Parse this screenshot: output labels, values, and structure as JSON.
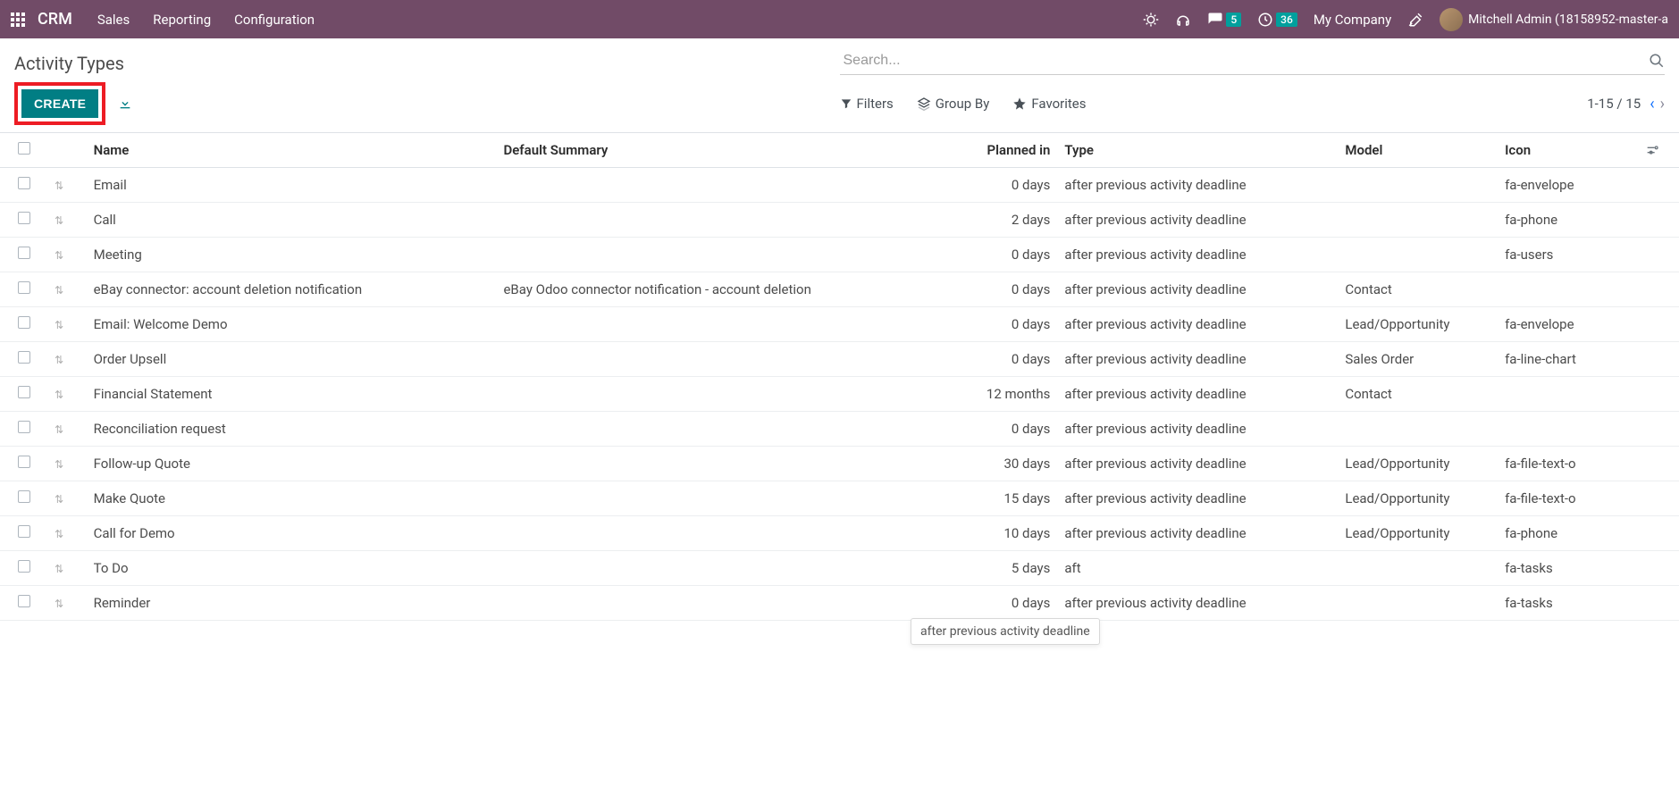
{
  "topnav": {
    "brand": "CRM",
    "items": [
      "Sales",
      "Reporting",
      "Configuration"
    ],
    "msg_badge": "5",
    "activity_badge": "36",
    "company": "My Company",
    "user": "Mitchell Admin (18158952-master-a"
  },
  "cp": {
    "title": "Activity Types",
    "search_placeholder": "Search...",
    "create_label": "CREATE",
    "filters_label": "Filters",
    "groupby_label": "Group By",
    "favorites_label": "Favorites",
    "pager_range": "1-15",
    "pager_total": "15"
  },
  "columns": {
    "name": "Name",
    "summary": "Default Summary",
    "planned": "Planned in",
    "type": "Type",
    "model": "Model",
    "icon": "Icon"
  },
  "rows": [
    {
      "name": "Email",
      "summary": "",
      "planned": "0 days",
      "type": "after previous activity deadline",
      "model": "",
      "icon": "fa-envelope"
    },
    {
      "name": "Call",
      "summary": "",
      "planned": "2 days",
      "type": "after previous activity deadline",
      "model": "",
      "icon": "fa-phone"
    },
    {
      "name": "Meeting",
      "summary": "",
      "planned": "0 days",
      "type": "after previous activity deadline",
      "model": "",
      "icon": "fa-users"
    },
    {
      "name": "eBay connector: account deletion notification",
      "summary": "eBay Odoo connector notification - account deletion",
      "planned": "0 days",
      "type": "after previous activity deadline",
      "model": "Contact",
      "icon": ""
    },
    {
      "name": "Email: Welcome Demo",
      "summary": "",
      "planned": "0 days",
      "type": "after previous activity deadline",
      "model": "Lead/Opportunity",
      "icon": "fa-envelope"
    },
    {
      "name": "Order Upsell",
      "summary": "",
      "planned": "0 days",
      "type": "after previous activity deadline",
      "model": "Sales Order",
      "icon": "fa-line-chart"
    },
    {
      "name": "Financial Statement",
      "summary": "",
      "planned": "12 months",
      "type": "after previous activity deadline",
      "model": "Contact",
      "icon": ""
    },
    {
      "name": "Reconciliation request",
      "summary": "",
      "planned": "0 days",
      "type": "after previous activity deadline",
      "model": "",
      "icon": ""
    },
    {
      "name": "Follow-up Quote",
      "summary": "",
      "planned": "30 days",
      "type": "after previous activity deadline",
      "model": "Lead/Opportunity",
      "icon": "fa-file-text-o"
    },
    {
      "name": "Make Quote",
      "summary": "",
      "planned": "15 days",
      "type": "after previous activity deadline",
      "model": "Lead/Opportunity",
      "icon": "fa-file-text-o"
    },
    {
      "name": "Call for Demo",
      "summary": "",
      "planned": "10 days",
      "type": "after previous activity deadline",
      "model": "Lead/Opportunity",
      "icon": "fa-phone"
    },
    {
      "name": "To Do",
      "summary": "",
      "planned": "5 days",
      "type": "aft",
      "model": "",
      "icon": "fa-tasks"
    },
    {
      "name": "Reminder",
      "summary": "",
      "planned": "0 days",
      "type": "after previous activity deadline",
      "model": "",
      "icon": "fa-tasks"
    }
  ],
  "tooltip": {
    "text": "after previous activity deadline"
  }
}
